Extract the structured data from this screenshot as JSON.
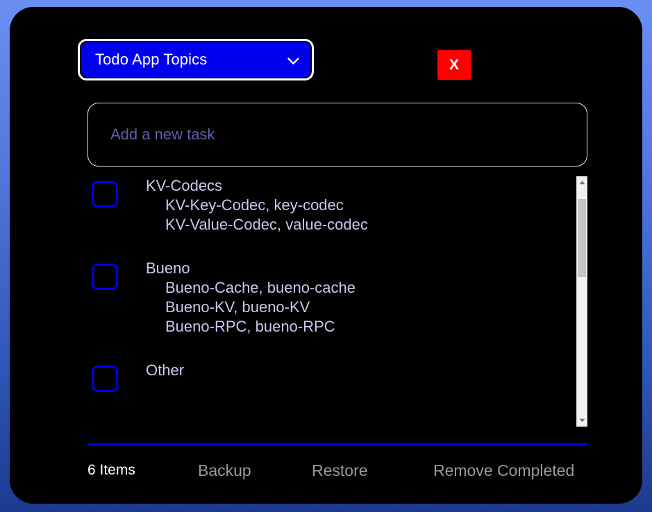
{
  "window": {
    "background_top_color": "#6b8ef2",
    "background_bottom_color": "#1d3a8f",
    "panel_color": "#000000"
  },
  "header": {
    "topic_select": {
      "selected_label": "Todo App Topics",
      "chevron_icon": "chevron-down-icon",
      "accent_color": "#0000ee"
    },
    "close_button": {
      "label": "X",
      "color": "#ff0000"
    }
  },
  "new_task": {
    "value": "",
    "placeholder": "Add a new task"
  },
  "tasks": [
    {
      "title": "KV-Codecs",
      "checked": false,
      "sublines": [
        "KV-Key-Codec, key-codec",
        "KV-Value-Codec, value-codec"
      ]
    },
    {
      "title": "Bueno",
      "checked": false,
      "sublines": [
        "Bueno-Cache, bueno-cache",
        "Bueno-KV, bueno-KV",
        "Bueno-RPC, bueno-RPC"
      ]
    },
    {
      "title": "Other",
      "checked": false,
      "sublines": []
    }
  ],
  "scrollbar": {
    "up_arrow_icon": "triangle-up-icon",
    "down_arrow_icon": "triangle-down-icon",
    "thumb_top_percent": 5,
    "thumb_height_percent": 34
  },
  "footer": {
    "count_label": "6 Items",
    "backup_label": "Backup",
    "restore_label": "Restore",
    "remove_completed_label": "Remove Completed",
    "divider_color": "#0000ee"
  }
}
